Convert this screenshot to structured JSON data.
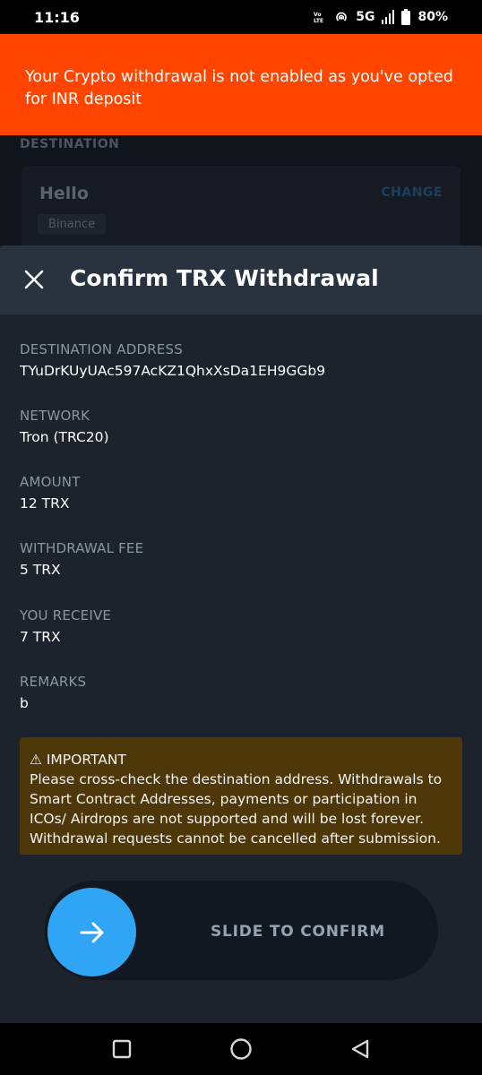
{
  "status_bar": {
    "time": "11:16",
    "network_label": "5G",
    "battery": "80%"
  },
  "banner": {
    "message": "Your Crypto withdrawal is not enabled as you've opted for INR deposit"
  },
  "background_page": {
    "section_label": "DESTINATION",
    "card_name": "Hello",
    "card_tag": "Binance",
    "change_label": "CHANGE"
  },
  "sheet": {
    "title": "Confirm TRX Withdrawal",
    "fields": [
      {
        "label": "DESTINATION ADDRESS",
        "value": "TYuDrKUyUAc597AcKZ1QhxXsDa1EH9GGb9"
      },
      {
        "label": "NETWORK",
        "value": "Tron (TRC20)"
      },
      {
        "label": "AMOUNT",
        "value": "12 TRX"
      },
      {
        "label": "WITHDRAWAL FEE",
        "value": "5 TRX"
      },
      {
        "label": "YOU RECEIVE",
        "value": "7 TRX"
      },
      {
        "label": "REMARKS",
        "value": "b"
      }
    ],
    "important": {
      "heading": "⚠ IMPORTANT",
      "text": "Please cross-check the destination address. Withdrawals to Smart Contract Addresses, payments or participation in ICOs/ Airdrops are not supported and will be lost forever. Withdrawal requests cannot be cancelled after submission."
    },
    "slider_label": "SLIDE TO CONFIRM"
  },
  "icons": {
    "close": "close-icon",
    "arrow": "arrow-right-icon",
    "nav_recents": "square-icon",
    "nav_home": "circle-icon",
    "nav_back": "triangle-back-icon"
  },
  "colors": {
    "banner": "#ff4500",
    "accent": "#30a4f5",
    "warning_bg": "#4e380a"
  }
}
